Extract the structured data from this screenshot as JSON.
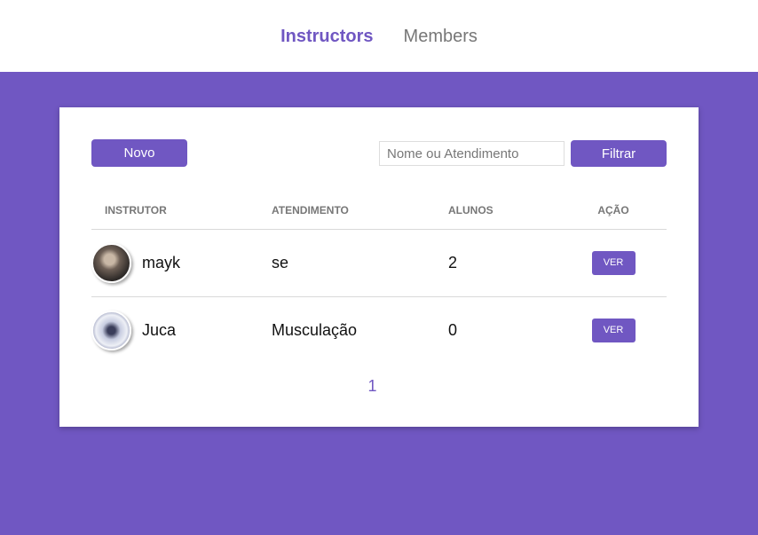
{
  "nav": {
    "items": [
      {
        "label": "Instructors",
        "active": true
      },
      {
        "label": "Members",
        "active": false
      }
    ]
  },
  "toolbar": {
    "new_label": "Novo",
    "search_placeholder": "Nome ou Atendimento",
    "search_value": "",
    "filter_label": "Filtrar"
  },
  "table": {
    "headers": [
      "Instrutor",
      "Atendimento",
      "Alunos",
      "Ação"
    ],
    "rows": [
      {
        "name": "mayk",
        "atendimento": "se",
        "alunos": "2",
        "action": "VER"
      },
      {
        "name": "Juca",
        "atendimento": "Musculação",
        "alunos": "0",
        "action": "VER"
      }
    ]
  },
  "pagination": {
    "pages": [
      "1"
    ]
  },
  "colors": {
    "accent": "#7057c2",
    "background": "#7057c2",
    "card": "#ffffff"
  }
}
